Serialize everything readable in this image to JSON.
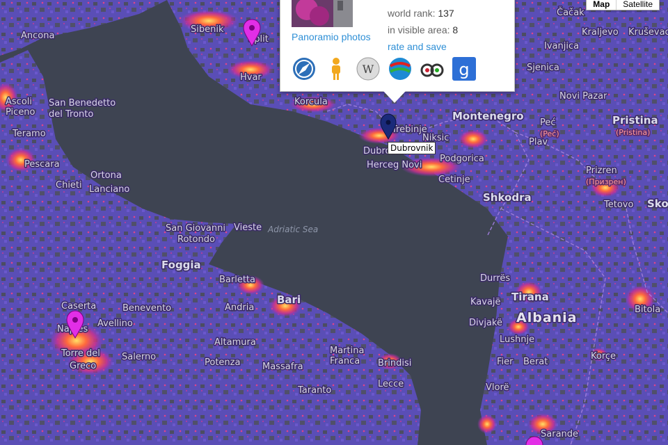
{
  "map": {
    "type_control": {
      "map": "Map",
      "satellite": "Satellite"
    },
    "sea_label": "Adriatic Sea",
    "country_labels": [
      "Albania",
      "Montenegro"
    ],
    "cities": [
      "Ancona",
      "San Benedetto",
      "del Tronto",
      "Ascoli",
      "Piceno",
      "Teramo",
      "Pescara",
      "Chieti",
      "Ortona",
      "Lanciano",
      "San Giovanni",
      "Rotondo",
      "Vieste",
      "Foggia",
      "Barletta",
      "Andria",
      "Bari",
      "Caserta",
      "Benevento",
      "Avellino",
      "Naples",
      "Torre del",
      "Greco",
      "Salerno",
      "Altamura",
      "Potenza",
      "Martina",
      "Franca",
      "Massafra",
      "Brindisi",
      "Taranto",
      "Lecce",
      "Sibenik",
      "Split",
      "Hvar",
      "Korcula",
      "Dubrovnik",
      "Herceg Novi",
      "Trebinje",
      "Niksic",
      "Podgorica",
      "Cetinje",
      "Shkodra",
      "Durrës",
      "Kavajë",
      "Tirana",
      "Divjakë",
      "Lushnje",
      "Fier",
      "Berat",
      "Vlorë",
      "Korçe",
      "Sarande",
      "Bitola",
      "Skopje",
      "Tetovo",
      "Prizren",
      "Pristina",
      "Peć",
      "Novi Pazar",
      "Sjenica",
      "Ivanjica",
      "Kraljevo",
      "Kruševac",
      "Čačak",
      "Plav"
    ],
    "cities_local": [
      "(Pristina)",
      "(Призрен)",
      "(Peć)"
    ],
    "tooltip": "Dubrovnik"
  },
  "popup": {
    "panoramio_link": "Panoramio photos",
    "world_rank_label": "world rank:",
    "world_rank_value": "137",
    "visible_area_label": "in visible area:",
    "visible_area_value": "8",
    "rate_link": "rate and save",
    "icons": [
      "compass-icon",
      "pegman-icon",
      "wikipedia-icon",
      "wikitravel-icon",
      "tripadvisor-icon",
      "google-icon"
    ]
  },
  "colors": {
    "water": "#3e4452",
    "land": "#5c4fb8",
    "hot": "#ffd24a",
    "link": "#2e8fd6",
    "pin": "#e22ee6",
    "pin_selected": "#1a2a7a"
  }
}
